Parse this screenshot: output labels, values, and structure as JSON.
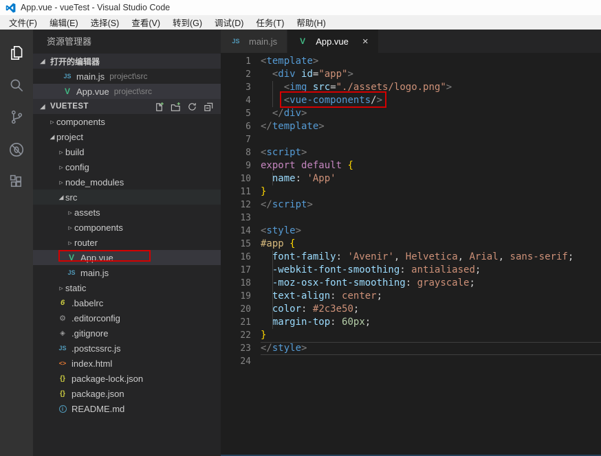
{
  "window": {
    "title": "App.vue - vueTest - Visual Studio Code"
  },
  "menu": {
    "items": [
      "文件(F)",
      "编辑(E)",
      "选择(S)",
      "查看(V)",
      "转到(G)",
      "调试(D)",
      "任务(T)",
      "帮助(H)"
    ]
  },
  "activity_bar": {
    "items": [
      {
        "id": "explorer",
        "icon": "files-icon",
        "active": true
      },
      {
        "id": "search",
        "icon": "search-icon",
        "active": false
      },
      {
        "id": "source-control",
        "icon": "git-branch-icon",
        "active": false
      },
      {
        "id": "debug",
        "icon": "debug-icon",
        "active": false
      },
      {
        "id": "extensions",
        "icon": "extensions-icon",
        "active": false
      }
    ]
  },
  "sidebar": {
    "title": "资源管理器",
    "open_editors": {
      "header": "打开的编辑器",
      "items": [
        {
          "icon": "js",
          "label": "main.js",
          "desc": "project\\src",
          "selected": false
        },
        {
          "icon": "vue",
          "label": "App.vue",
          "desc": "project\\src",
          "selected": true
        }
      ]
    },
    "tree": {
      "header": "VUETEST",
      "actions": [
        "new-file",
        "new-folder",
        "refresh",
        "collapse-all"
      ],
      "items": [
        {
          "label": "components",
          "type": "folder",
          "state": "collapsed",
          "indent": 0
        },
        {
          "label": "project",
          "type": "folder",
          "state": "expanded",
          "indent": 0
        },
        {
          "label": "build",
          "type": "folder",
          "state": "collapsed",
          "indent": 1
        },
        {
          "label": "config",
          "type": "folder",
          "state": "collapsed",
          "indent": 1
        },
        {
          "label": "node_modules",
          "type": "folder",
          "state": "collapsed",
          "indent": 1
        },
        {
          "label": "src",
          "type": "folder",
          "state": "expanded",
          "indent": 1,
          "highlight": true
        },
        {
          "label": "assets",
          "type": "folder",
          "state": "collapsed",
          "indent": 2
        },
        {
          "label": "components",
          "type": "folder",
          "state": "collapsed",
          "indent": 2
        },
        {
          "label": "router",
          "type": "folder",
          "state": "collapsed",
          "indent": 2
        },
        {
          "label": "App.vue",
          "type": "file",
          "icon": "vue",
          "indent": 2,
          "selected": true,
          "annotated": true
        },
        {
          "label": "main.js",
          "type": "file",
          "icon": "js",
          "indent": 2
        },
        {
          "label": "static",
          "type": "folder",
          "state": "collapsed",
          "indent": 1
        },
        {
          "label": ".babelrc",
          "type": "file",
          "icon": "babel",
          "indent": 1
        },
        {
          "label": ".editorconfig",
          "type": "file",
          "icon": "editorconfig",
          "indent": 1
        },
        {
          "label": ".gitignore",
          "type": "file",
          "icon": "git",
          "indent": 1
        },
        {
          "label": ".postcssrc.js",
          "type": "file",
          "icon": "js",
          "indent": 1
        },
        {
          "label": "index.html",
          "type": "file",
          "icon": "html",
          "indent": 1
        },
        {
          "label": "package-lock.json",
          "type": "file",
          "icon": "json",
          "indent": 1
        },
        {
          "label": "package.json",
          "type": "file",
          "icon": "json",
          "indent": 1
        },
        {
          "label": "README.md",
          "type": "file",
          "icon": "info",
          "indent": 1
        }
      ]
    }
  },
  "editor": {
    "tabs": [
      {
        "label": "main.js",
        "icon": "js",
        "active": false
      },
      {
        "label": "App.vue",
        "icon": "vue",
        "active": true,
        "close": "×"
      }
    ],
    "code": {
      "lines": [
        {
          "n": 1,
          "t": [
            [
              "p",
              "<"
            ],
            [
              "t",
              "template"
            ],
            [
              "p",
              ">"
            ]
          ]
        },
        {
          "n": 2,
          "t": [
            [
              "w",
              "  "
            ],
            [
              "p",
              "<"
            ],
            [
              "t",
              "div"
            ],
            [
              "w",
              " "
            ],
            [
              "a",
              "id"
            ],
            [
              "o",
              "="
            ],
            [
              "s",
              "\"app\""
            ],
            [
              "p",
              ">"
            ]
          ]
        },
        {
          "n": 3,
          "t": [
            [
              "w",
              "    "
            ],
            [
              "p",
              "<"
            ],
            [
              "t",
              "img"
            ],
            [
              "w",
              " "
            ],
            [
              "a",
              "src"
            ],
            [
              "o",
              "="
            ],
            [
              "s",
              "\"./assets/logo.png\""
            ],
            [
              "p",
              ">"
            ]
          ],
          "guide": true
        },
        {
          "n": 4,
          "t": [
            [
              "w",
              "    "
            ],
            [
              "p",
              "<"
            ],
            [
              "t",
              "vue-components"
            ],
            [
              "o",
              "/"
            ],
            [
              "p",
              ">"
            ]
          ],
          "guide": true,
          "box": true
        },
        {
          "n": 5,
          "t": [
            [
              "w",
              "  "
            ],
            [
              "p",
              "</"
            ],
            [
              "t",
              "div"
            ],
            [
              "p",
              ">"
            ]
          ]
        },
        {
          "n": 6,
          "t": [
            [
              "p",
              "</"
            ],
            [
              "t",
              "template"
            ],
            [
              "p",
              ">"
            ]
          ]
        },
        {
          "n": 7,
          "t": []
        },
        {
          "n": 8,
          "t": [
            [
              "p",
              "<"
            ],
            [
              "t",
              "script"
            ],
            [
              "p",
              ">"
            ]
          ]
        },
        {
          "n": 9,
          "t": [
            [
              "k",
              "export"
            ],
            [
              "w",
              " "
            ],
            [
              "k",
              "default"
            ],
            [
              "w",
              " "
            ],
            [
              "b",
              "{"
            ]
          ]
        },
        {
          "n": 10,
          "t": [
            [
              "w",
              "  "
            ],
            [
              "a",
              "name"
            ],
            [
              "o",
              ":"
            ],
            [
              "w",
              " "
            ],
            [
              "s",
              "'App'"
            ]
          ],
          "guide": true
        },
        {
          "n": 11,
          "t": [
            [
              "b",
              "}"
            ]
          ]
        },
        {
          "n": 12,
          "t": [
            [
              "p",
              "</"
            ],
            [
              "t",
              "script"
            ],
            [
              "p",
              ">"
            ]
          ]
        },
        {
          "n": 13,
          "t": []
        },
        {
          "n": 14,
          "t": [
            [
              "p",
              "<"
            ],
            [
              "t",
              "style"
            ],
            [
              "p",
              ">"
            ]
          ]
        },
        {
          "n": 15,
          "t": [
            [
              "i",
              "#app"
            ],
            [
              "w",
              " "
            ],
            [
              "b",
              "{"
            ]
          ]
        },
        {
          "n": 16,
          "t": [
            [
              "w",
              "  "
            ],
            [
              "a",
              "font-family"
            ],
            [
              "o",
              ":"
            ],
            [
              "w",
              " "
            ],
            [
              "s",
              "'Avenir'"
            ],
            [
              "o",
              ","
            ],
            [
              "w",
              " "
            ],
            [
              "v",
              "Helvetica"
            ],
            [
              "o",
              ","
            ],
            [
              "w",
              " "
            ],
            [
              "v",
              "Arial"
            ],
            [
              "o",
              ","
            ],
            [
              "w",
              " "
            ],
            [
              "v",
              "sans-serif"
            ],
            [
              "o",
              ";"
            ]
          ],
          "guide": true
        },
        {
          "n": 17,
          "t": [
            [
              "w",
              "  "
            ],
            [
              "a",
              "-webkit-font-smoothing"
            ],
            [
              "o",
              ":"
            ],
            [
              "w",
              " "
            ],
            [
              "v",
              "antialiased"
            ],
            [
              "o",
              ";"
            ]
          ],
          "guide": true
        },
        {
          "n": 18,
          "t": [
            [
              "w",
              "  "
            ],
            [
              "a",
              "-moz-osx-font-smoothing"
            ],
            [
              "o",
              ":"
            ],
            [
              "w",
              " "
            ],
            [
              "v",
              "grayscale"
            ],
            [
              "o",
              ";"
            ]
          ],
          "guide": true
        },
        {
          "n": 19,
          "t": [
            [
              "w",
              "  "
            ],
            [
              "a",
              "text-align"
            ],
            [
              "o",
              ":"
            ],
            [
              "w",
              " "
            ],
            [
              "v",
              "center"
            ],
            [
              "o",
              ";"
            ]
          ],
          "guide": true
        },
        {
          "n": 20,
          "t": [
            [
              "w",
              "  "
            ],
            [
              "a",
              "color"
            ],
            [
              "o",
              ":"
            ],
            [
              "w",
              " "
            ],
            [
              "v",
              "#2c3e50"
            ],
            [
              "o",
              ";"
            ]
          ],
          "guide": true
        },
        {
          "n": 21,
          "t": [
            [
              "w",
              "  "
            ],
            [
              "a",
              "margin-top"
            ],
            [
              "o",
              ":"
            ],
            [
              "w",
              " "
            ],
            [
              "n2",
              "60px"
            ],
            [
              "o",
              ";"
            ]
          ],
          "guide": true
        },
        {
          "n": 22,
          "t": [
            [
              "b",
              "}"
            ]
          ]
        },
        {
          "n": 23,
          "t": [
            [
              "p",
              "</"
            ],
            [
              "t",
              "style"
            ],
            [
              "p",
              ">"
            ]
          ],
          "current": true
        },
        {
          "n": 24,
          "t": []
        }
      ]
    }
  },
  "colors": {
    "annotation_red": "#d40000",
    "vue_green": "#41b883",
    "js_blue": "#519aba",
    "accent_blue": "#007acc",
    "editor_bg": "#1e1e1e",
    "sidebar_bg": "#252526",
    "activitybar_bg": "#333333"
  }
}
